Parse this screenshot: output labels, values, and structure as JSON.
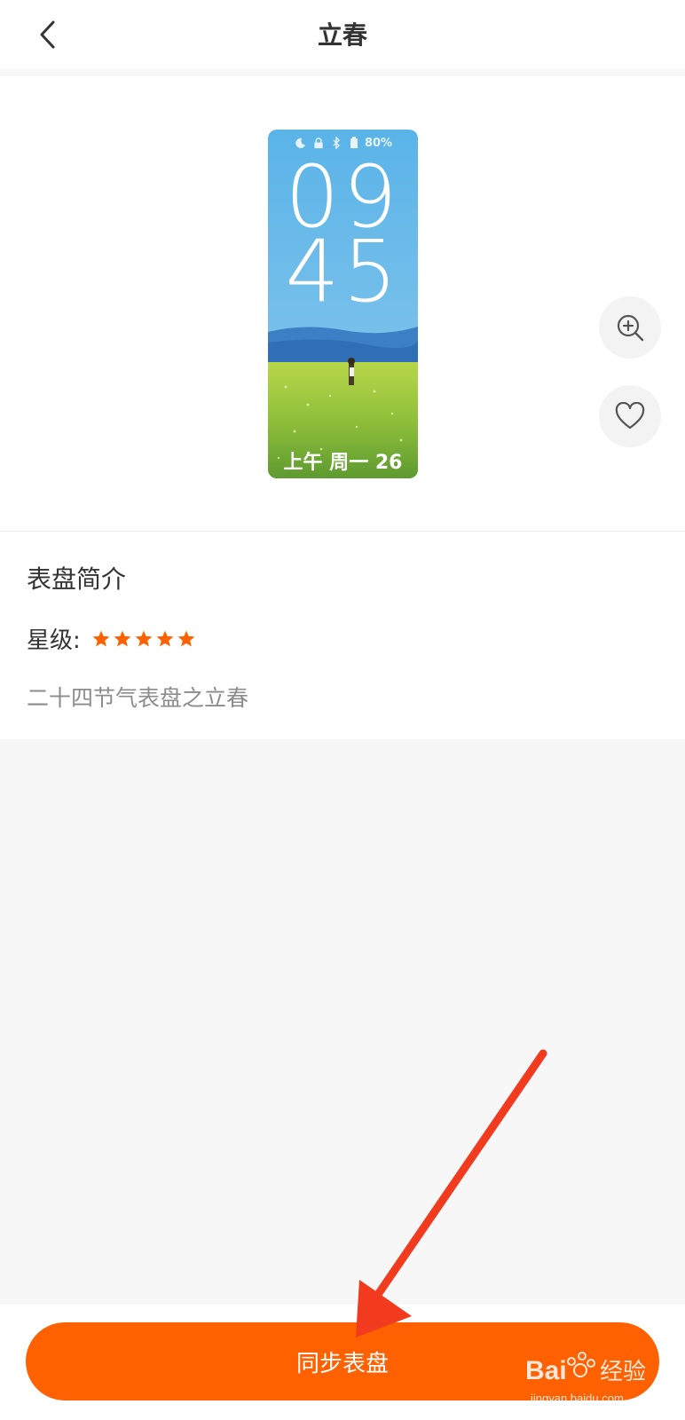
{
  "header": {
    "title": "立春",
    "back_icon": "chevron-left-icon"
  },
  "watchface": {
    "status_battery": "80%",
    "status_icons": [
      "moon-icon",
      "lock-icon",
      "bluetooth-icon",
      "battery-icon"
    ],
    "hour": "09",
    "minute": "45",
    "date_line": "上午 周一 26"
  },
  "side_actions": {
    "zoom_icon": "zoom-in-icon",
    "favorite_icon": "heart-icon"
  },
  "info": {
    "title": "表盘简介",
    "rating_label": "星级:",
    "rating_value": 5,
    "rating_max": 5,
    "description": "二十四节气表盘之立春"
  },
  "footer": {
    "sync_button_label": "同步表盘"
  },
  "colors": {
    "accent": "#ff6000",
    "arrow": "#f23a1e",
    "text_primary": "#333333",
    "text_secondary": "#8c8c8c"
  }
}
